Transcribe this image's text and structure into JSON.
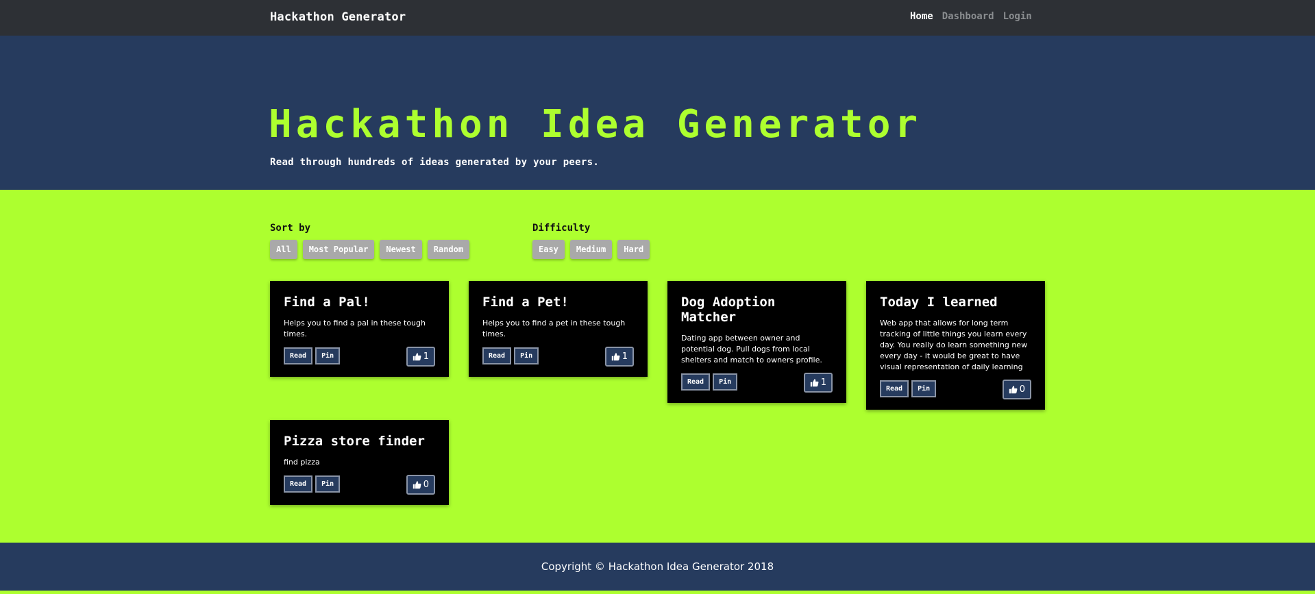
{
  "navbar": {
    "brand": "Hackathon Generator",
    "links": [
      {
        "label": "Home",
        "active": true
      },
      {
        "label": "Dashboard",
        "active": false
      },
      {
        "label": "Login",
        "active": false
      }
    ]
  },
  "hero": {
    "title": "Hackathon Idea Generator",
    "subtitle": "Read through hundreds of ideas generated by your peers."
  },
  "filters": {
    "sort": {
      "label": "Sort by",
      "options": [
        "All",
        "Most Popular",
        "Newest",
        "Random"
      ]
    },
    "difficulty": {
      "label": "Difficulty",
      "options": [
        "Easy",
        "Medium",
        "Hard"
      ]
    }
  },
  "cards": [
    {
      "title": "Find a Pal!",
      "description": "Helps you to find a pal in these tough times.",
      "read_label": "Read",
      "pin_label": "Pin",
      "likes": "1"
    },
    {
      "title": "Find a Pet!",
      "description": "Helps you to find a pet in these tough times.",
      "read_label": "Read",
      "pin_label": "Pin",
      "likes": "1"
    },
    {
      "title": "Dog Adoption Matcher",
      "description": "Dating app between owner and potential dog. Pull dogs from local shelters and match to owners profile.",
      "read_label": "Read",
      "pin_label": "Pin",
      "likes": "1"
    },
    {
      "title": "Today I learned",
      "description": "Web app that allows for long term tracking of little things you learn every day. You really do learn something new every day - it would be great to have visual representation of daily learning",
      "read_label": "Read",
      "pin_label": "Pin",
      "likes": "0"
    },
    {
      "title": "Pizza store finder",
      "description": "find pizza",
      "read_label": "Read",
      "pin_label": "Pin",
      "likes": "0"
    }
  ],
  "icons": {
    "like": "thumbs-up-icon"
  },
  "colors": {
    "accent": "#adff2f",
    "navy": "#263b5e",
    "navbar": "#2d3035",
    "button_gray": "#a9a9a9"
  },
  "footer": {
    "copyright": "Copyright © Hackathon Idea Generator 2018"
  }
}
